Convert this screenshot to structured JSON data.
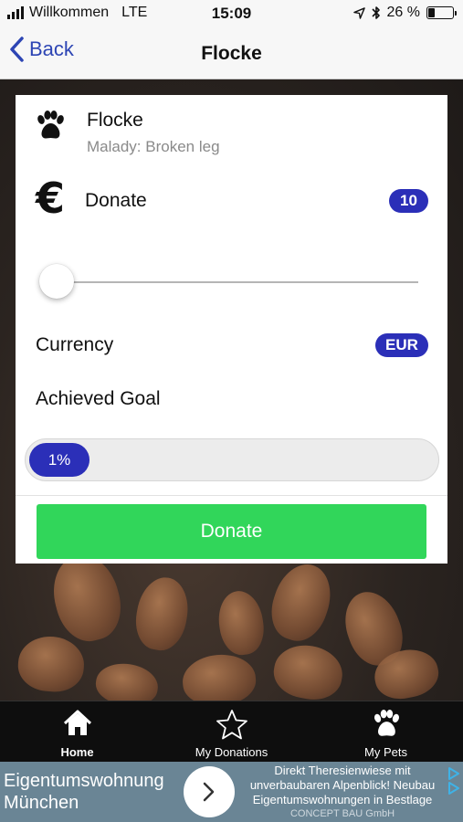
{
  "status_bar": {
    "carrier": "Willkommen",
    "network": "LTE",
    "time": "15:09",
    "battery": "26 %",
    "battery_level": 0.26
  },
  "nav": {
    "back_label": "Back",
    "title": "Flocke"
  },
  "pet": {
    "name": "Flocke",
    "malady": "Malady: Broken leg",
    "icon": "paw-icon"
  },
  "donation": {
    "icon": "euro-icon",
    "euro_symbol": "€",
    "label": "Donate",
    "amount": "10",
    "slider_level": 0.0,
    "currency_label": "Currency",
    "currency": "EUR",
    "goal_label": "Achieved Goal",
    "goal_percent_text": "1%",
    "goal_fraction": 0.01,
    "button_label": "Donate"
  },
  "tabs": [
    {
      "label": "Home",
      "icon": "home-icon",
      "active": true
    },
    {
      "label": "My Donations",
      "icon": "star-icon",
      "active": false
    },
    {
      "label": "My Pets",
      "icon": "paw-icon",
      "active": false
    }
  ],
  "ad": {
    "title": "Eigentumswohnung München",
    "body": "Direkt Theresienwiese mit unverbaubaren Alpenblick! Neubau Eigentumswohnungen in Bestlage",
    "brand": "CONCEPT BAU GmbH"
  },
  "colors": {
    "accent": "#2b2fb8",
    "back_link": "#2d45b4",
    "donate_button": "#31d65a",
    "ad_background": "#6a8595"
  }
}
